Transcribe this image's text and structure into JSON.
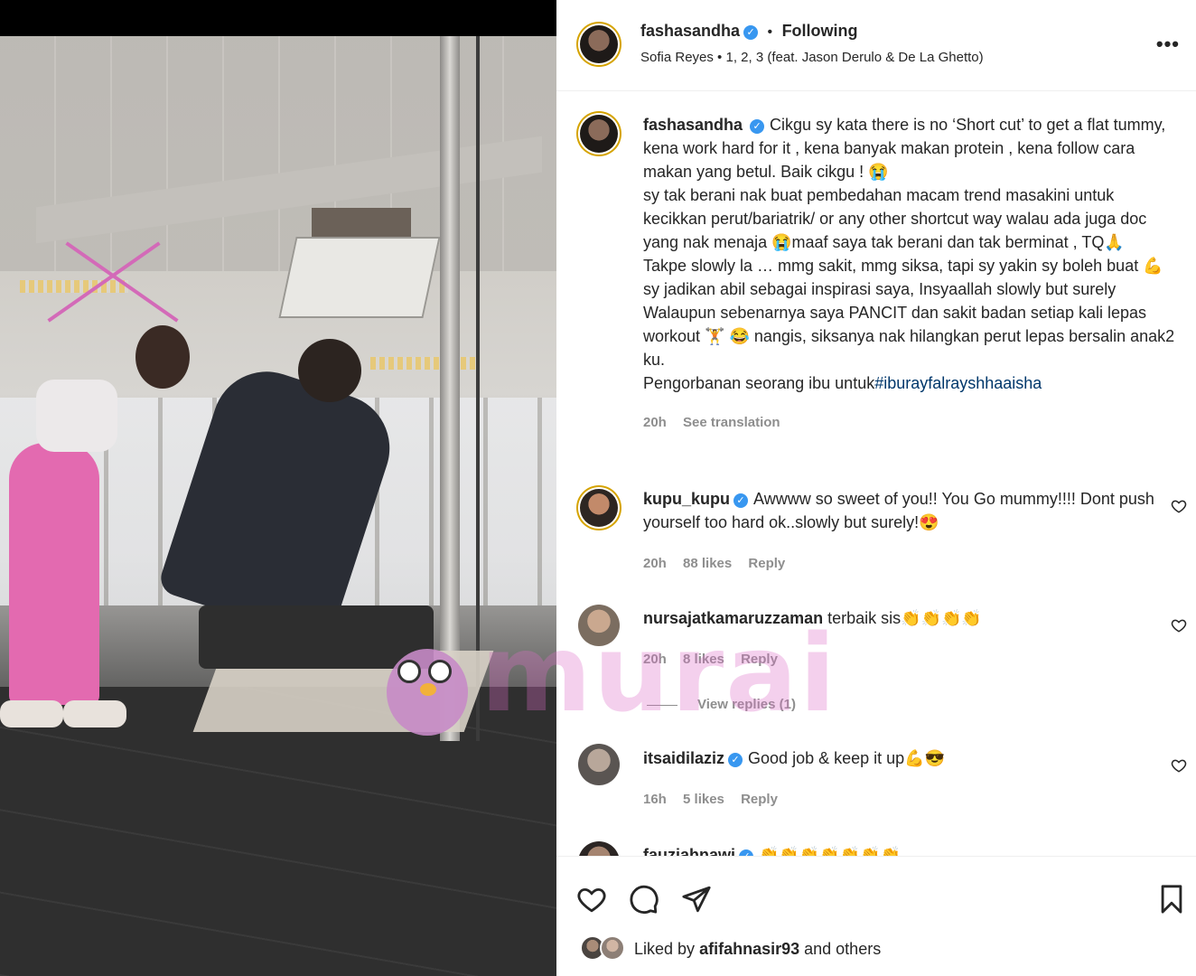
{
  "post": {
    "author": "fashasandha",
    "follow_status": "Following",
    "audio_artist": "Sofia Reyes",
    "audio_separator": "•",
    "audio_track": "1, 2, 3 (feat. Jason Derulo & De La Ghetto)",
    "more_label": "•••",
    "watermark": "murai"
  },
  "caption": {
    "username": "fashasandha",
    "line1": "Cikgu sy kata there is no ‘Short cut’ to get a flat tummy, kena work hard for it , kena banyak makan protein , kena follow cara makan yang betul. Baik cikgu ! 😭",
    "line2": "sy tak berani nak buat pembedahan macam trend masakini untuk kecikkan perut/bariatrik/ or any other shortcut way walau ada juga doc yang nak menaja 😭maaf saya tak berani dan tak berminat , TQ🙏",
    "line3": "Takpe slowly la … mmg sakit, mmg siksa, tapi sy yakin sy boleh buat 💪 sy jadikan abil sebagai inspirasi saya, Insyaallah slowly but surely Walaupun sebenarnya saya PANCIT dan sakit badan setiap kali lepas workout 🏋️ 😂 nangis, siksanya nak hilangkan perut lepas bersalin anak2 ku.",
    "line4_prefix": "Pengorbanan seorang ibu untuk",
    "hashtag": "#iburayfalrayshhaaisha",
    "time": "20h",
    "see_translation": "See translation"
  },
  "comments": [
    {
      "username": "kupu_kupu",
      "verified": true,
      "text": "Awwww so sweet of you!! You Go mummy!!!! Dont push yourself too hard ok..slowly but surely!😍",
      "time": "20h",
      "likes": "88 likes",
      "reply": "Reply"
    },
    {
      "username": "nursajatkamaruzzaman",
      "verified": false,
      "text": "terbaik sis👏👏👏👏",
      "time": "20h",
      "likes": "8 likes",
      "reply": "Reply",
      "view_replies": "View replies (1)"
    },
    {
      "username": "itsaidilaziz",
      "verified": true,
      "text": "Good job & keep it up💪😎",
      "time": "16h",
      "likes": "5 likes",
      "reply": "Reply"
    },
    {
      "username": "fauziahnawi",
      "verified": true,
      "text": "👏👏👏👏👏👏👏"
    }
  ],
  "footer": {
    "liked_by_prefix": "Liked by",
    "liked_by_user": "afifahnasir93",
    "liked_by_suffix": "and others"
  },
  "colors": {
    "verified": "#3897f0",
    "hashtag": "#00376b",
    "muted": "#8e8e8e",
    "watermark": "#dc6ec8"
  }
}
